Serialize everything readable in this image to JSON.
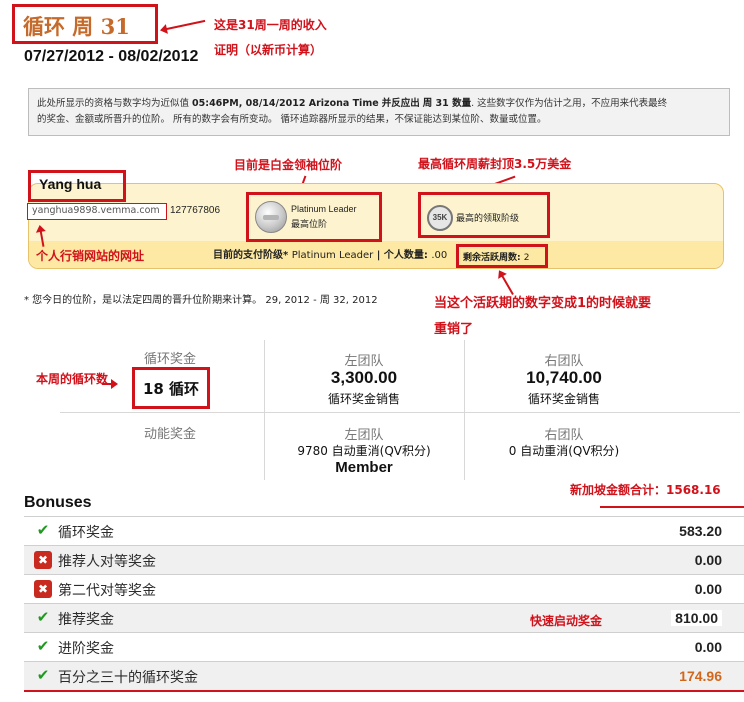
{
  "header": {
    "title": "循环 周 31",
    "date_range": "07/27/2012 - 08/02/2012"
  },
  "notice": {
    "text_a": "此处所显示的资格与数字均为近似值",
    "time": "05:46PM, 08/14/2012 Arizona Time",
    "text_b": "并反应出",
    "week": "周 31 数量",
    "text_c": ". 这些数字仅作为估计之用，不应用来代表最终",
    "line2": "的奖金、金额或所晋升的位阶。 所有的数字会有所变动。 循环追踪器所显示的结果，不保证能达到某位阶、数量或位置。"
  },
  "member": {
    "name": "Yang hua",
    "url": "yanghua9898.vemma.com",
    "id": "127767806"
  },
  "rank": {
    "title": "Platinum Leader",
    "subtitle": "最高位阶"
  },
  "cap": {
    "badge": "35K",
    "label": "最高的领取阶级"
  },
  "status": {
    "paid_rank_label": "目前的支付阶级*",
    "paid_rank": "Platinum Leader",
    "personal_volume_label": "个人数量:",
    "personal_volume": ".00",
    "remaining_label": "剩余活跃周数:",
    "remaining": "2"
  },
  "promo_note": "* 您今日的位阶，是以法定四周的晋升位阶期来计算。  29, 2012 - 周 32, 2012",
  "cycle": {
    "cycle_bonus_label": "循环奖金",
    "cycles": "18 循环",
    "left_team_label": "左团队",
    "left_sales": "3,300.00",
    "left_sales_label": "循环奖金销售",
    "right_team_label": "右团队",
    "right_sales": "10,740.00",
    "right_sales_label": "循环奖金销售",
    "momentum_label": "动能奖金",
    "left_team_label2": "左团队",
    "left_autoship": "9780 自动重消(QV积分)",
    "left_member": "Member",
    "right_team_label2": "右团队",
    "right_autoship": "0 自动重消(QV积分)"
  },
  "bonuses": {
    "title": "Bonuses",
    "items": [
      {
        "status": "ok",
        "name": "循环奖金",
        "amount": "583.20"
      },
      {
        "status": "no",
        "name": "推荐人对等奖金",
        "amount": "0.00"
      },
      {
        "status": "no",
        "name": "第二代对等奖金",
        "amount": "0.00"
      },
      {
        "status": "ok",
        "name": "推荐奖金",
        "amount": "810.00"
      },
      {
        "status": "ok",
        "name": "进阶奖金",
        "amount": "0.00"
      },
      {
        "status": "ok",
        "name": "百分之三十的循环奖金",
        "amount": "174.96"
      }
    ]
  },
  "annotations": {
    "week_income_1": "这是31周一周的收入",
    "week_income_2": "证明（以新币计算）",
    "current_rank": "目前是白金领袖位阶",
    "max_cap": "最高循环周薪封顶3.5万美金",
    "personal_site": "个人行销网站的网址",
    "requalify_1": "当这个活跃期的数字变成1的时候就要",
    "requalify_2": "重销了",
    "weekly_cycles": "本周的循环数",
    "total": "新加坡金额合计：1568.16",
    "fast_start": "快速启动奖金"
  },
  "colors": {
    "annotation_red": "#d0121b",
    "title_orange": "#c56a2a",
    "panel_yellow": "#fdf4cf",
    "check_green": "#1f9a1f"
  },
  "icons": {
    "ok": "check-icon",
    "no": "cross-icon"
  }
}
